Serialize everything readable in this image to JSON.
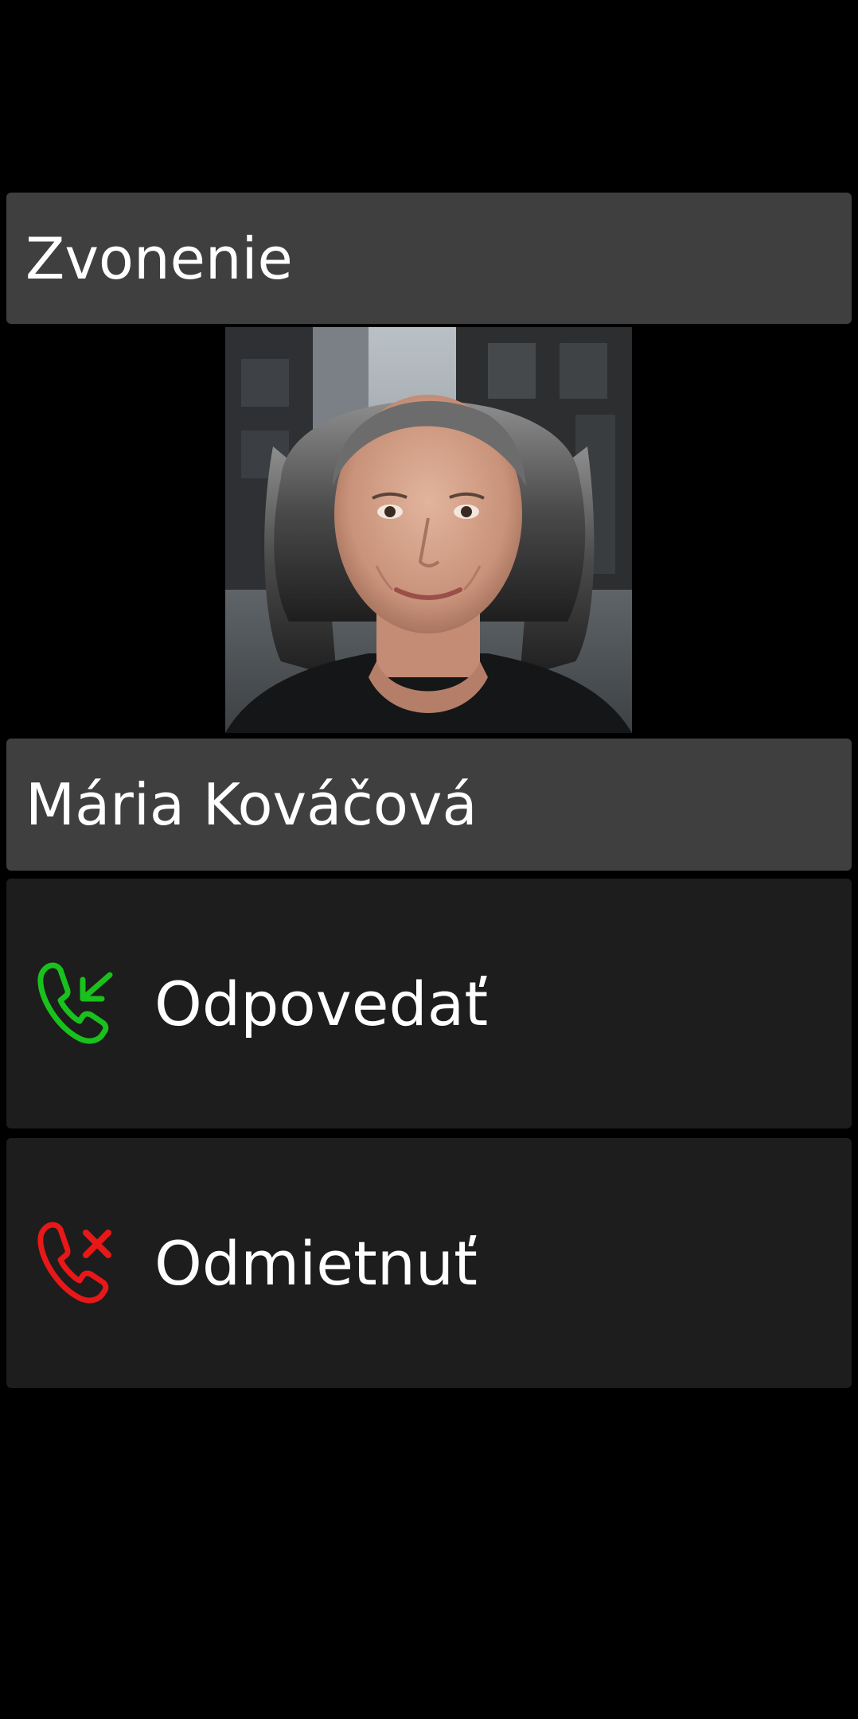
{
  "call": {
    "status": "Zvonenie",
    "caller_name": "Mária Kováčová",
    "photo": {
      "alt": "Mária Kováčová",
      "description": "Portrait of an older woman with shoulder-length gray hair on a city street"
    }
  },
  "actions": {
    "answer": {
      "label": "Odpovedať",
      "icon": "phone-incoming-icon",
      "color": "#19c11c"
    },
    "decline": {
      "label": "Odmietnuť",
      "icon": "phone-declined-icon",
      "color": "#e81818"
    }
  },
  "colors": {
    "background": "#000000",
    "header_bg": "#3f3f3f",
    "button_bg": "#1d1d1d",
    "text": "#ffffff"
  }
}
